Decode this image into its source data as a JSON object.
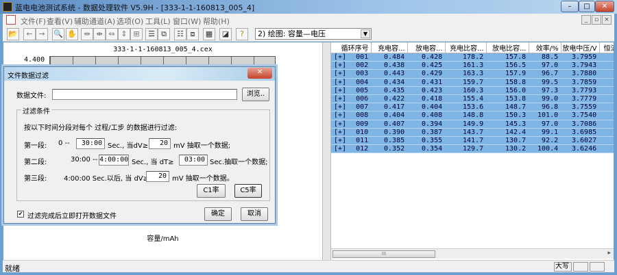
{
  "window": {
    "title": "蓝电电池测试系统 - 数据处理软件 V5.9H - [333-1-1-160813_005_4]",
    "min": "–",
    "max": "□",
    "close": "✕"
  },
  "menu": [
    "文件(F)",
    "查看(V)",
    "辅助通道(A)",
    "选项(O)",
    "工具(L)",
    "窗口(W)",
    "帮助(H)"
  ],
  "mdi": {
    "min": "_",
    "restore": "▫",
    "close": "×"
  },
  "toolbar": {
    "icons": [
      "open-icon",
      "back-icon",
      "forward-icon",
      "zoom-icon",
      "hand-icon",
      "split-h-icon",
      "join-icon",
      "fit-width-icon",
      "fit-height-icon",
      "fit-all-icon",
      "list-icon",
      "copy-list-icon",
      "table-icon",
      "export-icon",
      "grid-icon",
      "chart-icon",
      "help-icon"
    ],
    "glyphs": [
      "📂",
      "←",
      "→",
      "🔍",
      "✋",
      "⇹",
      "⇼",
      "⇔",
      "⇕",
      "⊞",
      "☰",
      "⧉",
      "☷",
      "⧈",
      "▦",
      "◪",
      "?"
    ],
    "plot_select": "2) 绘图: 容量—电压",
    "dropdown": "▼"
  },
  "chart": {
    "title": "333-1-1-160813_005_4.cex",
    "ytick": "4.400",
    "xlabel": "容量/mAh"
  },
  "table": {
    "headers": [
      "循环序号",
      "充电容...",
      "放电容...",
      "充电比容...",
      "放电比容...",
      "效率/%",
      "放电中压/V",
      "恒流"
    ],
    "rows": [
      [
        "[+]",
        "001",
        "0.484",
        "0.428",
        "178.2",
        "157.8",
        "88.5",
        "3.7959"
      ],
      [
        "[+]",
        "002",
        "0.438",
        "0.425",
        "161.3",
        "156.5",
        "97.0",
        "3.7943"
      ],
      [
        "[+]",
        "003",
        "0.443",
        "0.429",
        "163.3",
        "157.9",
        "96.7",
        "3.7880"
      ],
      [
        "[+]",
        "004",
        "0.434",
        "0.431",
        "159.7",
        "158.8",
        "99.5",
        "3.7859"
      ],
      [
        "[+]",
        "005",
        "0.435",
        "0.423",
        "160.3",
        "156.0",
        "97.3",
        "3.7793"
      ],
      [
        "[+]",
        "006",
        "0.422",
        "0.418",
        "155.4",
        "153.8",
        "99.0",
        "3.7779"
      ],
      [
        "[+]",
        "007",
        "0.417",
        "0.404",
        "153.6",
        "148.7",
        "96.8",
        "3.7559"
      ],
      [
        "[+]",
        "008",
        "0.404",
        "0.408",
        "148.8",
        "150.3",
        "101.0",
        "3.7540"
      ],
      [
        "[+]",
        "009",
        "0.407",
        "0.394",
        "149.9",
        "145.3",
        "97.0",
        "3.7086"
      ],
      [
        "[+]",
        "010",
        "0.390",
        "0.387",
        "143.7",
        "142.4",
        "99.1",
        "3.6985"
      ],
      [
        "[+]",
        "011",
        "0.385",
        "0.355",
        "141.7",
        "130.7",
        "92.2",
        "3.6027"
      ],
      [
        "[+]",
        "012",
        "0.352",
        "0.354",
        "129.7",
        "130.2",
        "100.4",
        "3.6246"
      ]
    ]
  },
  "scroll": {
    "thumb": "III",
    "right": "▸"
  },
  "status": {
    "text": "就绪",
    "caps": "大写"
  },
  "dialog": {
    "title": "文件数据过滤",
    "close": "✕",
    "file_label": "数据文件:",
    "file_value": "",
    "browse": "浏览..",
    "group": "过滤条件",
    "intro": "按以下时间分段对每个 过程/工步 的数据进行过滤:",
    "s1": {
      "label": "第一段:",
      "from": "0 --",
      "to": "30:00",
      "mid": "Sec., 当dV≥",
      "dv": "20",
      "tail": "mV 抽取一个数据;"
    },
    "s2": {
      "label": "第二段:",
      "from": "30:00 --",
      "to": "4:00:00",
      "mid": "Sec., 当 dT≥",
      "dt": "03:00",
      "tail": "Sec.抽取一个数据;"
    },
    "s3": {
      "label": "第三段:",
      "text": "4:00:00 Sec.以后, 当 dV≥",
      "dv": "20",
      "tail": "mV 抽取一个数据。"
    },
    "c1": "C1率",
    "c5": "C5率",
    "checkbox": "过滤完成后立即打开数据文件",
    "check": "✔",
    "ok": "确定",
    "cancel": "取消"
  }
}
